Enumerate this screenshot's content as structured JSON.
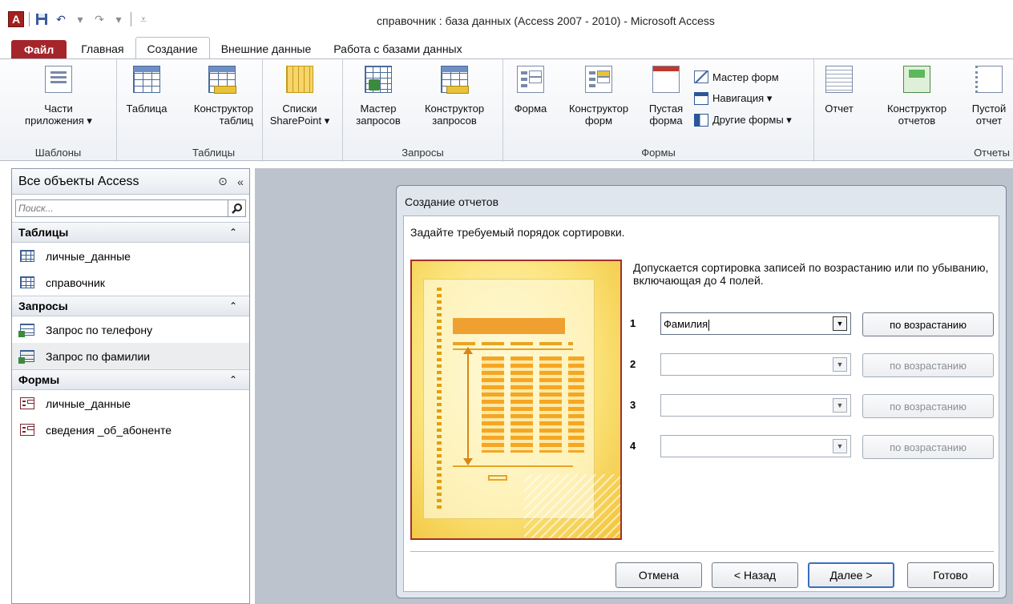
{
  "app": {
    "icon_letter": "A",
    "title": "справочник : база данных (Access 2007 - 2010)  -  Microsoft Access"
  },
  "tabs": [
    {
      "label": "Файл"
    },
    {
      "label": "Главная"
    },
    {
      "label": "Создание",
      "active": true
    },
    {
      "label": "Внешние данные"
    },
    {
      "label": "Работа с базами данных"
    }
  ],
  "ribbon": {
    "templates": {
      "label": "Шаблоны",
      "parts_line1": "Части",
      "parts_line2": "приложения ▾"
    },
    "tables": {
      "label": "Таблицы",
      "table": "Таблица",
      "design_line1": "Конструктор",
      "design_line2": "таблиц",
      "sp_line1": "Списки",
      "sp_line2": "SharePoint ▾"
    },
    "queries": {
      "label": "Запросы",
      "wizard_line1": "Мастер",
      "wizard_line2": "запросов",
      "design_line1": "Конструктор",
      "design_line2": "запросов"
    },
    "forms": {
      "label": "Формы",
      "form": "Форма",
      "design_line1": "Конструктор",
      "design_line2": "форм",
      "blank_line1": "Пустая",
      "blank_line2": "форма",
      "wizard": "Мастер форм",
      "navigation": "Навигация ▾",
      "more": "Другие формы ▾"
    },
    "reports": {
      "label": "Отчеты",
      "report": "Отчет",
      "design_line1": "Конструктор",
      "design_line2": "отчетов",
      "blank_line1": "Пустой",
      "blank_line2": "отчет"
    }
  },
  "nav": {
    "title": "Все объекты Access",
    "search_placeholder": "Поиск...",
    "sections": [
      {
        "title": "Таблицы",
        "items": [
          "личные_данные",
          "справочник"
        ]
      },
      {
        "title": "Запросы",
        "items": [
          "Запрос по телефону",
          "Запрос по фамилии"
        ]
      },
      {
        "title": "Формы",
        "items": [
          "личные_данные",
          "сведения _об_абоненте"
        ]
      }
    ]
  },
  "dialog": {
    "title": "Создание отчетов",
    "heading": "Задайте требуемый порядок сортировки.",
    "description": "Допускается сортировка записей по возрастанию или по убыванию, включающая до 4 полей.",
    "rows": [
      {
        "num": "1",
        "value": "Фамилия",
        "sort": "по возрастанию"
      },
      {
        "num": "2",
        "value": "",
        "sort": "по возрастанию"
      },
      {
        "num": "3",
        "value": "",
        "sort": "по возрастанию"
      },
      {
        "num": "4",
        "value": "",
        "sort": "по возрастанию"
      }
    ],
    "buttons": {
      "cancel": "Отмена",
      "back": "< Назад",
      "next": "Далее >",
      "finish": "Готово"
    }
  }
}
